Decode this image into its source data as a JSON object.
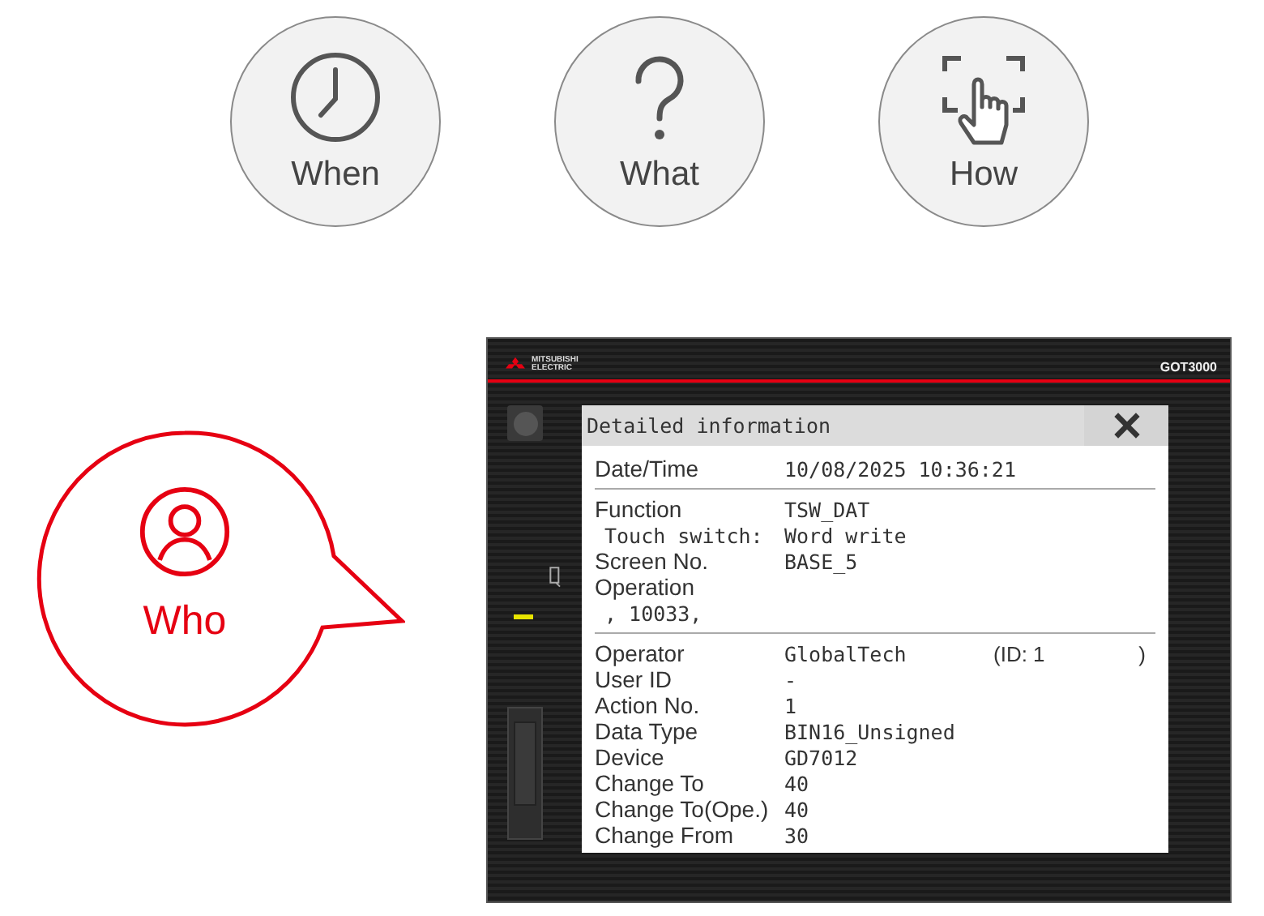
{
  "top_icons": [
    {
      "kind": "clock",
      "label": "When"
    },
    {
      "kind": "question",
      "label": "What"
    },
    {
      "kind": "touch",
      "label": "How"
    }
  ],
  "who_bubble": {
    "label": "Who"
  },
  "device": {
    "brand": "MITSUBISHI ELECTRIC",
    "model": "GOT3000",
    "dialog": {
      "title": "Detailed information",
      "groups": [
        [
          {
            "kind": "main",
            "label": "Date/Time",
            "value": "10/08/2025 10:36:21"
          }
        ],
        [
          {
            "kind": "main",
            "label": "Function",
            "value": "TSW_DAT"
          },
          {
            "kind": "sub",
            "label": "Touch switch:",
            "value": "Word write"
          },
          {
            "kind": "main",
            "label": "Screen No.",
            "value": "BASE_5"
          },
          {
            "kind": "main",
            "label": "Operation"
          },
          {
            "kind": "sub",
            "label": ", 10033,"
          }
        ],
        [
          {
            "kind": "main",
            "label": "Operator",
            "value": "GlobalTech",
            "extra": "(ID: 1",
            "extra_end": ")"
          },
          {
            "kind": "main",
            "label": "User ID",
            "value": "-"
          },
          {
            "kind": "main",
            "label": "Action No.",
            "value": "1"
          },
          {
            "kind": "main",
            "label": "Data Type",
            "value": "BIN16_Unsigned"
          },
          {
            "kind": "main",
            "label": "Device",
            "value": "GD7012"
          },
          {
            "kind": "main",
            "label": "Change To",
            "value": "40"
          },
          {
            "kind": "main",
            "label": "Change To(Ope.)",
            "value": "40"
          },
          {
            "kind": "main",
            "label": "Change From",
            "value": "30"
          }
        ]
      ]
    }
  }
}
